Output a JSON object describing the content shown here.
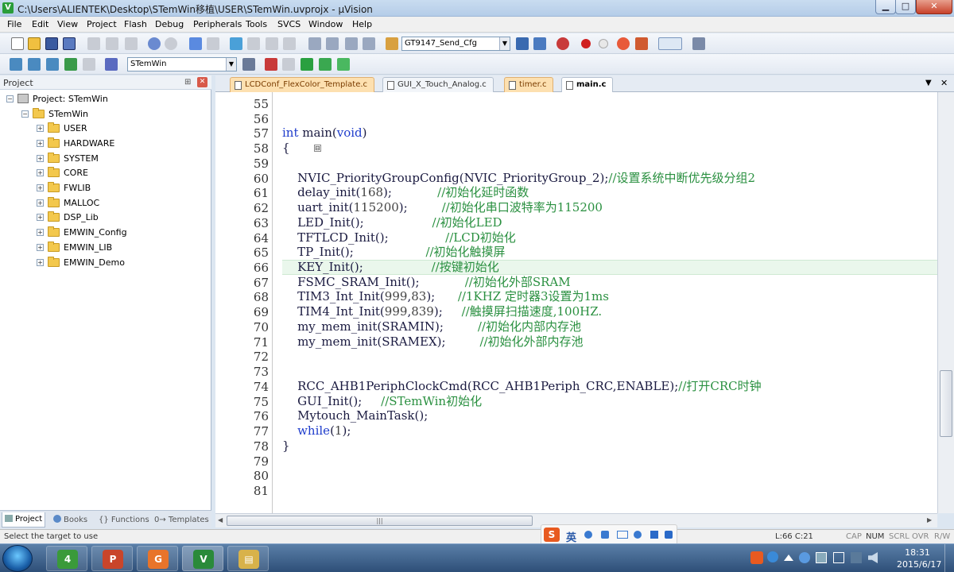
{
  "window": {
    "title": "C:\\Users\\ALIENTEK\\Desktop\\STemWin移植\\USER\\STemWin.uvprojx - µVision",
    "app_icon": "V",
    "controls": {
      "minimize": "▁",
      "maximize": "□",
      "close": "✕"
    }
  },
  "menu": [
    "File",
    "Edit",
    "View",
    "Project",
    "Flash",
    "Debug",
    "Peripherals",
    "Tools",
    "SVCS",
    "Window",
    "Help"
  ],
  "toolbar1": {
    "target_combo": "GT9147_Send_Cfg"
  },
  "toolbar2": {
    "project_combo": "STemWin"
  },
  "project_panel": {
    "title": "Project",
    "pin": "⊞",
    "close": "✕",
    "root": "Project: STemWin",
    "target": "STemWin",
    "groups": [
      "USER",
      "HARDWARE",
      "SYSTEM",
      "CORE",
      "FWLIB",
      "MALLOC",
      "DSP_Lib",
      "EMWIN_Config",
      "EMWIN_LIB",
      "EMWIN_Demo"
    ],
    "tabs": [
      "Project",
      "Books",
      "{} Functions",
      "0→ Templates"
    ]
  },
  "editor_tabs": [
    {
      "label": "LCDConf_FlexColor_Template.c",
      "style": "orange"
    },
    {
      "label": "GUI_X_Touch_Analog.c",
      "style": "normal"
    },
    {
      "label": "timer.c",
      "style": "orange"
    },
    {
      "label": "main.c",
      "style": "active"
    }
  ],
  "editor_tabbar_controls": {
    "dropdown": "▼",
    "close": "✕"
  },
  "code_lines": [
    {
      "n": "55",
      "parts": []
    },
    {
      "n": "56",
      "parts": []
    },
    {
      "n": "57",
      "parts": [
        {
          "t": "int",
          "c": "kw"
        },
        {
          "t": " main("
        },
        {
          "t": "void",
          "c": "kw"
        },
        {
          "t": ")"
        }
      ]
    },
    {
      "n": "58",
      "fold": "⊟",
      "parts": [
        {
          "t": "{"
        }
      ]
    },
    {
      "n": "59",
      "parts": []
    },
    {
      "n": "60",
      "parts": [
        {
          "t": "    NVIC_PriorityGroupConfig(NVIC_PriorityGroup_2);"
        },
        {
          "t": "//设置系统中断优先级分组2",
          "c": "cmt"
        }
      ]
    },
    {
      "n": "61",
      "parts": [
        {
          "t": "    delay_init("
        },
        {
          "t": "168",
          "c": "num"
        },
        {
          "t": ");            "
        },
        {
          "t": "//初始化延时函数",
          "c": "cmt"
        }
      ]
    },
    {
      "n": "62",
      "parts": [
        {
          "t": "    uart_init("
        },
        {
          "t": "115200",
          "c": "num"
        },
        {
          "t": ");         "
        },
        {
          "t": "//初始化串口波特率为115200",
          "c": "cmt"
        }
      ]
    },
    {
      "n": "63",
      "parts": [
        {
          "t": "    LED_Init();                  "
        },
        {
          "t": "//初始化LED",
          "c": "cmt"
        }
      ]
    },
    {
      "n": "64",
      "parts": [
        {
          "t": "    TFTLCD_Init();               "
        },
        {
          "t": "//LCD初始化",
          "c": "cmt"
        }
      ]
    },
    {
      "n": "65",
      "parts": [
        {
          "t": "    TP_Init();                   "
        },
        {
          "t": "//初始化触摸屏",
          "c": "cmt"
        }
      ]
    },
    {
      "n": "66",
      "highlight": true,
      "parts": [
        {
          "t": "    KEY_Init();                  "
        },
        {
          "t": "//按键初始化",
          "c": "cmt"
        }
      ]
    },
    {
      "n": "67",
      "parts": [
        {
          "t": "    FSMC_SRAM_Init();            "
        },
        {
          "t": "//初始化外部SRAM",
          "c": "cmt"
        }
      ]
    },
    {
      "n": "68",
      "parts": [
        {
          "t": "    TIM3_Int_Init("
        },
        {
          "t": "999",
          "c": "num"
        },
        {
          "t": ","
        },
        {
          "t": "83",
          "c": "num"
        },
        {
          "t": ");      "
        },
        {
          "t": "//1KHZ 定时器3设置为1ms",
          "c": "cmt"
        }
      ]
    },
    {
      "n": "69",
      "parts": [
        {
          "t": "    TIM4_Int_Init("
        },
        {
          "t": "999",
          "c": "num"
        },
        {
          "t": ","
        },
        {
          "t": "839",
          "c": "num"
        },
        {
          "t": ");     "
        },
        {
          "t": "//触摸屏扫描速度,100HZ.",
          "c": "cmt"
        }
      ]
    },
    {
      "n": "70",
      "parts": [
        {
          "t": "    my_mem_init(SRAMIN);         "
        },
        {
          "t": "//初始化内部内存池",
          "c": "cmt"
        }
      ]
    },
    {
      "n": "71",
      "parts": [
        {
          "t": "    my_mem_init(SRAMEX);         "
        },
        {
          "t": "//初始化外部内存池",
          "c": "cmt"
        }
      ]
    },
    {
      "n": "72",
      "parts": []
    },
    {
      "n": "73",
      "parts": []
    },
    {
      "n": "74",
      "parts": [
        {
          "t": "    RCC_AHB1PeriphClockCmd(RCC_AHB1Periph_CRC,ENABLE);"
        },
        {
          "t": "//打开CRC时钟",
          "c": "cmt"
        }
      ]
    },
    {
      "n": "75",
      "parts": [
        {
          "t": "    GUI_Init();     "
        },
        {
          "t": "//STemWin初始化",
          "c": "cmt"
        }
      ]
    },
    {
      "n": "76",
      "parts": [
        {
          "t": "    Mytouch_MainTask();"
        }
      ]
    },
    {
      "n": "77",
      "parts": [
        {
          "t": "    "
        },
        {
          "t": "while",
          "c": "kw"
        },
        {
          "t": "("
        },
        {
          "t": "1",
          "c": "num"
        },
        {
          "t": ");"
        }
      ]
    },
    {
      "n": "78",
      "parts": [
        {
          "t": "}"
        }
      ]
    },
    {
      "n": "79",
      "parts": []
    },
    {
      "n": "80",
      "parts": []
    },
    {
      "n": "81",
      "parts": []
    }
  ],
  "scrollbar": {
    "grip": "|||"
  },
  "ime": {
    "logo": "S",
    "lang": "英"
  },
  "statusbar": {
    "left": "Select the target to use",
    "position": "L:66 C:21",
    "indicators": [
      "CAP",
      "NUM",
      "SCRL",
      "OVR",
      "R/W"
    ]
  },
  "taskbar": {
    "apps": [
      {
        "label": "4",
        "color": "#3a9a3a"
      },
      {
        "label": "P",
        "color": "#c9452a"
      },
      {
        "label": "G",
        "color": "#e8742a"
      },
      {
        "label": "V",
        "color": "#2a8a3a"
      },
      {
        "label": "▤",
        "color": "#d8b24a"
      }
    ],
    "time": "18:31",
    "date": "2015/6/17"
  },
  "colors": {
    "keyword": "#1e3ccc",
    "comment": "#2a9040",
    "current_line": "#eaf7ec"
  }
}
